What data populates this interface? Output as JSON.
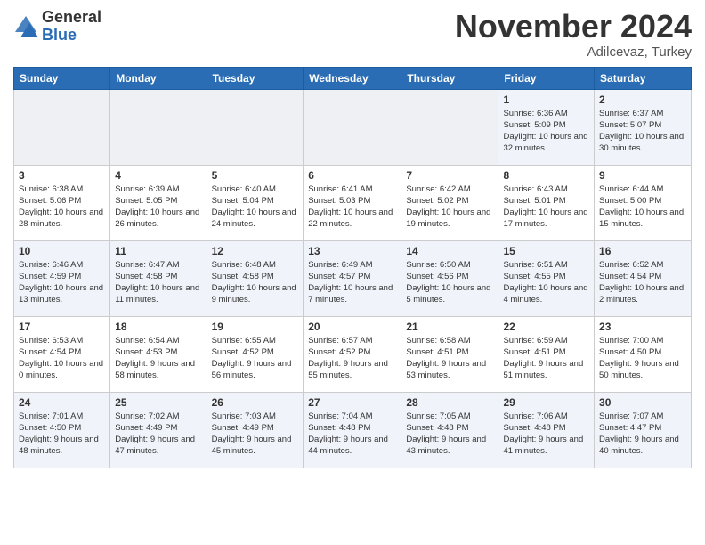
{
  "header": {
    "logo_line1": "General",
    "logo_line2": "Blue",
    "month": "November 2024",
    "location": "Adilcevaz, Turkey"
  },
  "weekdays": [
    "Sunday",
    "Monday",
    "Tuesday",
    "Wednesday",
    "Thursday",
    "Friday",
    "Saturday"
  ],
  "weeks": [
    [
      {
        "day": "",
        "info": ""
      },
      {
        "day": "",
        "info": ""
      },
      {
        "day": "",
        "info": ""
      },
      {
        "day": "",
        "info": ""
      },
      {
        "day": "",
        "info": ""
      },
      {
        "day": "1",
        "info": "Sunrise: 6:36 AM\nSunset: 5:09 PM\nDaylight: 10 hours\nand 32 minutes."
      },
      {
        "day": "2",
        "info": "Sunrise: 6:37 AM\nSunset: 5:07 PM\nDaylight: 10 hours\nand 30 minutes."
      }
    ],
    [
      {
        "day": "3",
        "info": "Sunrise: 6:38 AM\nSunset: 5:06 PM\nDaylight: 10 hours\nand 28 minutes."
      },
      {
        "day": "4",
        "info": "Sunrise: 6:39 AM\nSunset: 5:05 PM\nDaylight: 10 hours\nand 26 minutes."
      },
      {
        "day": "5",
        "info": "Sunrise: 6:40 AM\nSunset: 5:04 PM\nDaylight: 10 hours\nand 24 minutes."
      },
      {
        "day": "6",
        "info": "Sunrise: 6:41 AM\nSunset: 5:03 PM\nDaylight: 10 hours\nand 22 minutes."
      },
      {
        "day": "7",
        "info": "Sunrise: 6:42 AM\nSunset: 5:02 PM\nDaylight: 10 hours\nand 19 minutes."
      },
      {
        "day": "8",
        "info": "Sunrise: 6:43 AM\nSunset: 5:01 PM\nDaylight: 10 hours\nand 17 minutes."
      },
      {
        "day": "9",
        "info": "Sunrise: 6:44 AM\nSunset: 5:00 PM\nDaylight: 10 hours\nand 15 minutes."
      }
    ],
    [
      {
        "day": "10",
        "info": "Sunrise: 6:46 AM\nSunset: 4:59 PM\nDaylight: 10 hours\nand 13 minutes."
      },
      {
        "day": "11",
        "info": "Sunrise: 6:47 AM\nSunset: 4:58 PM\nDaylight: 10 hours\nand 11 minutes."
      },
      {
        "day": "12",
        "info": "Sunrise: 6:48 AM\nSunset: 4:58 PM\nDaylight: 10 hours\nand 9 minutes."
      },
      {
        "day": "13",
        "info": "Sunrise: 6:49 AM\nSunset: 4:57 PM\nDaylight: 10 hours\nand 7 minutes."
      },
      {
        "day": "14",
        "info": "Sunrise: 6:50 AM\nSunset: 4:56 PM\nDaylight: 10 hours\nand 5 minutes."
      },
      {
        "day": "15",
        "info": "Sunrise: 6:51 AM\nSunset: 4:55 PM\nDaylight: 10 hours\nand 4 minutes."
      },
      {
        "day": "16",
        "info": "Sunrise: 6:52 AM\nSunset: 4:54 PM\nDaylight: 10 hours\nand 2 minutes."
      }
    ],
    [
      {
        "day": "17",
        "info": "Sunrise: 6:53 AM\nSunset: 4:54 PM\nDaylight: 10 hours\nand 0 minutes."
      },
      {
        "day": "18",
        "info": "Sunrise: 6:54 AM\nSunset: 4:53 PM\nDaylight: 9 hours\nand 58 minutes."
      },
      {
        "day": "19",
        "info": "Sunrise: 6:55 AM\nSunset: 4:52 PM\nDaylight: 9 hours\nand 56 minutes."
      },
      {
        "day": "20",
        "info": "Sunrise: 6:57 AM\nSunset: 4:52 PM\nDaylight: 9 hours\nand 55 minutes."
      },
      {
        "day": "21",
        "info": "Sunrise: 6:58 AM\nSunset: 4:51 PM\nDaylight: 9 hours\nand 53 minutes."
      },
      {
        "day": "22",
        "info": "Sunrise: 6:59 AM\nSunset: 4:51 PM\nDaylight: 9 hours\nand 51 minutes."
      },
      {
        "day": "23",
        "info": "Sunrise: 7:00 AM\nSunset: 4:50 PM\nDaylight: 9 hours\nand 50 minutes."
      }
    ],
    [
      {
        "day": "24",
        "info": "Sunrise: 7:01 AM\nSunset: 4:50 PM\nDaylight: 9 hours\nand 48 minutes."
      },
      {
        "day": "25",
        "info": "Sunrise: 7:02 AM\nSunset: 4:49 PM\nDaylight: 9 hours\nand 47 minutes."
      },
      {
        "day": "26",
        "info": "Sunrise: 7:03 AM\nSunset: 4:49 PM\nDaylight: 9 hours\nand 45 minutes."
      },
      {
        "day": "27",
        "info": "Sunrise: 7:04 AM\nSunset: 4:48 PM\nDaylight: 9 hours\nand 44 minutes."
      },
      {
        "day": "28",
        "info": "Sunrise: 7:05 AM\nSunset: 4:48 PM\nDaylight: 9 hours\nand 43 minutes."
      },
      {
        "day": "29",
        "info": "Sunrise: 7:06 AM\nSunset: 4:48 PM\nDaylight: 9 hours\nand 41 minutes."
      },
      {
        "day": "30",
        "info": "Sunrise: 7:07 AM\nSunset: 4:47 PM\nDaylight: 9 hours\nand 40 minutes."
      }
    ]
  ]
}
